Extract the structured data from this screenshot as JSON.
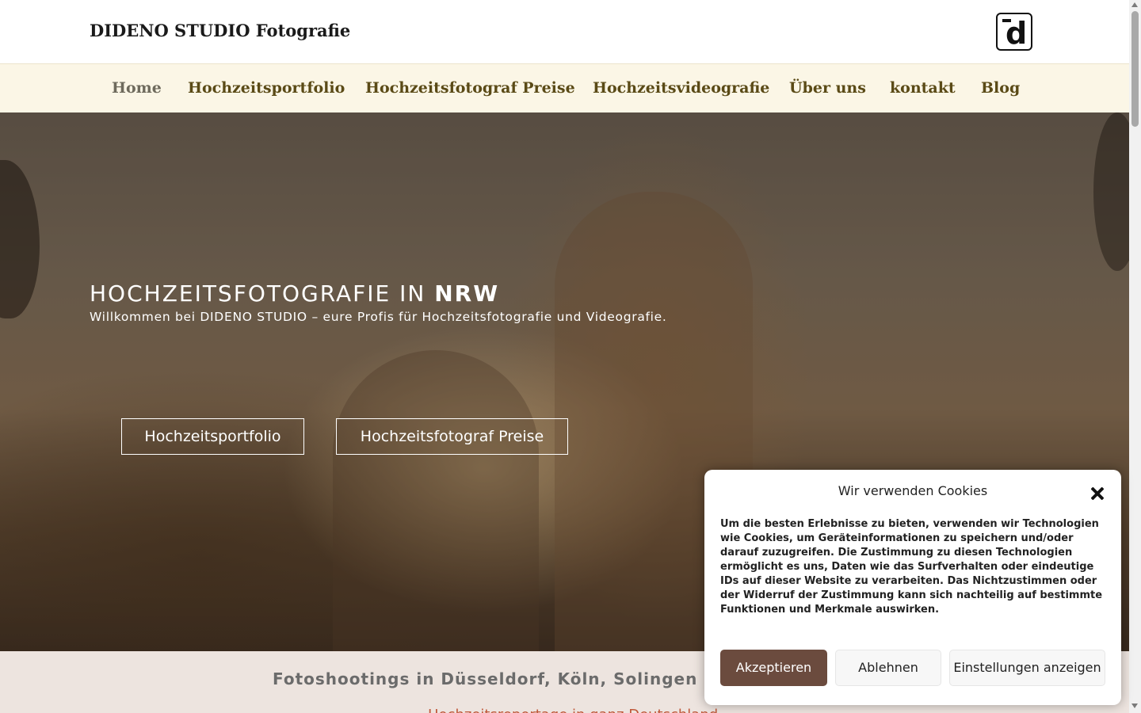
{
  "header": {
    "site_title": "DIDENO STUDIO Fotografie",
    "logo_letter": "d"
  },
  "nav": {
    "items": [
      {
        "label": "Home",
        "active": true
      },
      {
        "label": "Hochzeitsportfolio"
      },
      {
        "label": "Hochzeitsfotograf Preise"
      },
      {
        "label": "Hochzeitsvideografie"
      },
      {
        "label": "Über uns"
      },
      {
        "label": "kontakt"
      },
      {
        "label": "Blog"
      }
    ]
  },
  "hero": {
    "title_prefix": "HOCHZEITSFOTOGRAFIE IN ",
    "title_bold": "NRW",
    "subtitle": "Willkommen bei DIDENO STUDIO – eure Profis für Hochzeitsfotografie und Videografie.",
    "buttons": [
      {
        "label": "Hochzeitsportfolio"
      },
      {
        "label": "Hochzeitsfotograf Preise"
      }
    ]
  },
  "section": {
    "title": "Fotoshootings in Düsseldorf, Köln, Solingen",
    "link_partial": "Hochzeitsreportage in ganz Deutschland"
  },
  "cookie": {
    "title": "Wir verwenden Cookies",
    "text": "Um die besten Erlebnisse zu bieten, verwenden wir Technologien wie Cookies, um Geräteinformationen zu speichern und/oder darauf zuzugreifen. Die Zustimmung zu diesen Technologien ermöglicht es uns, Daten wie das Surfverhalten oder eindeutige IDs auf dieser Website zu verarbeiten. Das Nichtzustimmen oder der Widerruf der Zustimmung kann sich nachteilig auf bestimmte Funktionen und Merkmale auswirken.",
    "accept_label": "Akzeptieren",
    "deny_label": "Ablehnen",
    "preferences_label": "Einstellungen anzeigen"
  },
  "colors": {
    "nav_bg": "#fbf6e6",
    "nav_text": "#5a4a16",
    "accept_bg": "#6b4b3e",
    "band_bg": "#ede4df",
    "link": "#c0583a"
  },
  "icons": {
    "logo": "camera-d-logo-icon",
    "close": "close-icon"
  }
}
